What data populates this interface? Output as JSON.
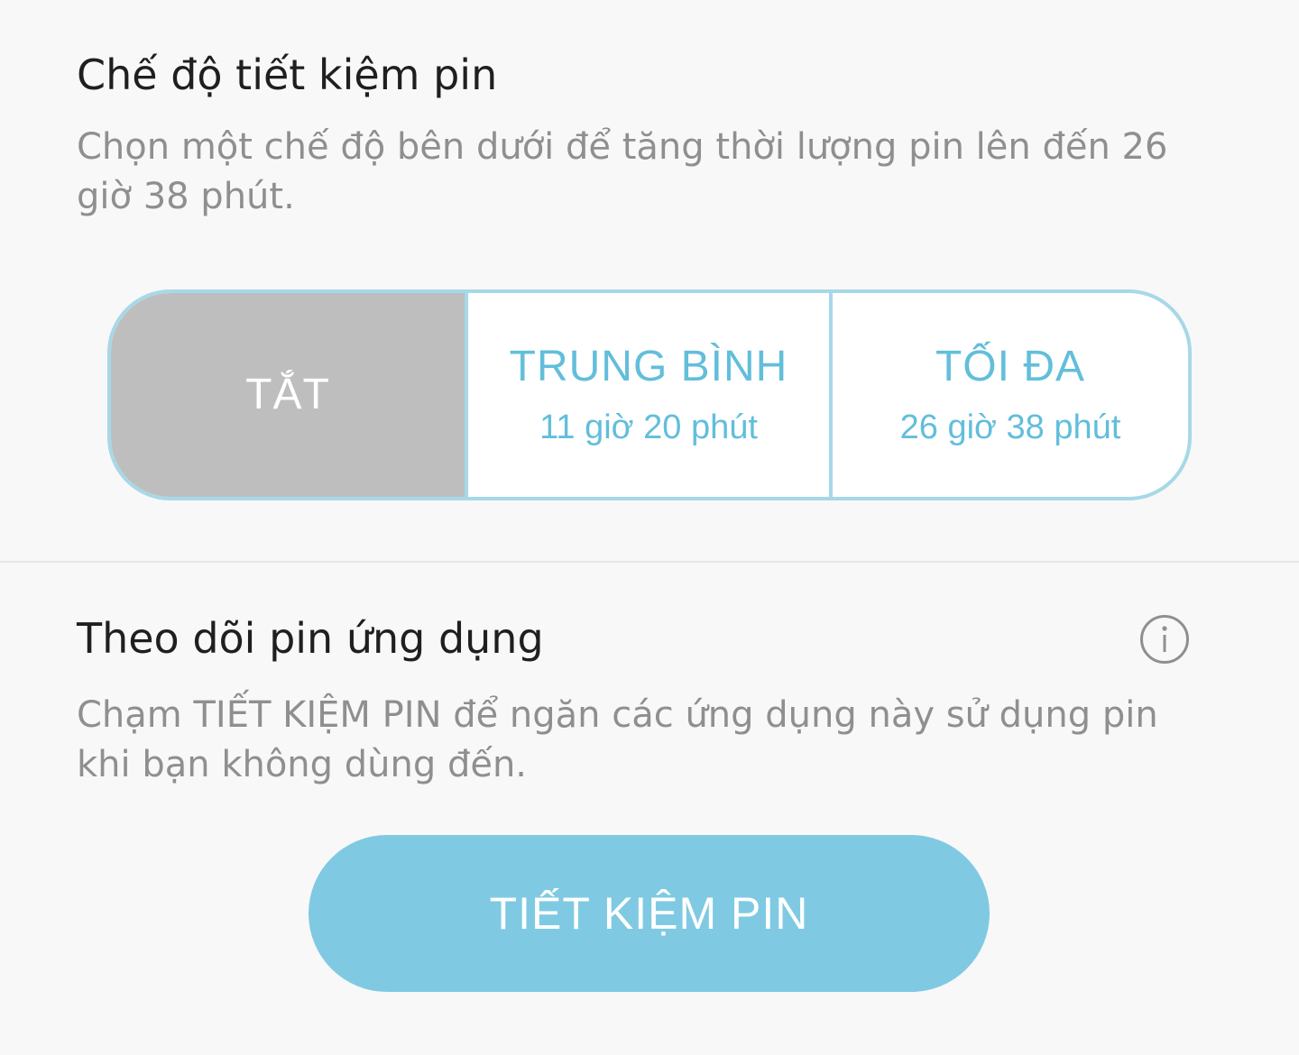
{
  "power_saving": {
    "title": "Chế độ tiết kiệm pin",
    "description": "Chọn một chế độ bên dưới để tăng thời lượng pin lên đến 26 giờ 38 phút.",
    "modes": [
      {
        "label": "TẮT",
        "time": "",
        "selected": true
      },
      {
        "label": "TRUNG BÌNH",
        "time": "11 giờ 20 phút",
        "selected": false
      },
      {
        "label": "TỐI ĐA",
        "time": "26 giờ 38 phút",
        "selected": false
      }
    ]
  },
  "app_monitor": {
    "title": "Theo dõi pin ứng dụng",
    "info_icon": "info-icon",
    "description": "Chạm TIẾT KIỆM PIN để ngăn các ứng dụng này sử dụng pin khi bạn không dùng đến.",
    "save_button_label": "TIẾT KIỆM PIN"
  },
  "colors": {
    "accent": "#62bedb",
    "button_fill": "#7fcae2",
    "selected_segment": "#bebebe",
    "segment_border": "#a7d8e8",
    "background": "#f8f8f8"
  }
}
